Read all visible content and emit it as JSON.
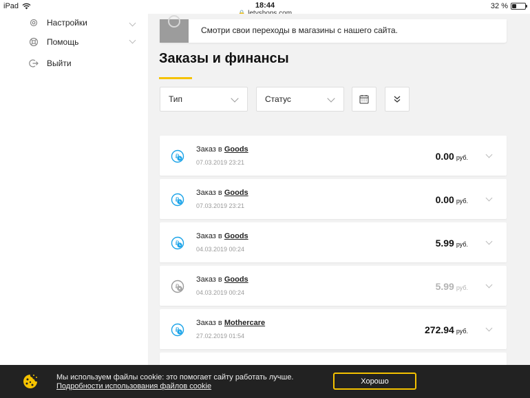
{
  "statusbar": {
    "device": "iPad",
    "time": "18:44",
    "battery": "32 %",
    "battery_level": 0.32
  },
  "browser": {
    "url": "letyshops.com"
  },
  "sidebar": {
    "items": [
      {
        "label": "Настройки",
        "icon": "gear-icon"
      },
      {
        "label": "Помощь",
        "icon": "lifebuoy-icon"
      },
      {
        "label": "Выйти",
        "icon": "logout-icon"
      }
    ]
  },
  "info_card": {
    "text": "Смотри свои переходы в магазины с нашего сайта."
  },
  "section": {
    "title": "Заказы и финансы"
  },
  "filters": {
    "type_label": "Тип",
    "status_label": "Статус"
  },
  "orders": [
    {
      "prefix": "Заказ в",
      "shop": "Goods",
      "date": "07.03.2019 23:21",
      "amount": "0.00",
      "currency": "руб.",
      "status": "pending"
    },
    {
      "prefix": "Заказ в",
      "shop": "Goods",
      "date": "07.03.2019 23:21",
      "amount": "0.00",
      "currency": "руб.",
      "status": "pending"
    },
    {
      "prefix": "Заказ в",
      "shop": "Goods",
      "date": "04.03.2019 00:24",
      "amount": "5.99",
      "currency": "руб.",
      "status": "pending"
    },
    {
      "prefix": "Заказ в",
      "shop": "Goods",
      "date": "04.03.2019 00:24",
      "amount": "5.99",
      "currency": "руб.",
      "status": "cancelled"
    },
    {
      "prefix": "Заказ в",
      "shop": "Mothercare",
      "date": "27.02.2019 01:54",
      "amount": "272.94",
      "currency": "руб.",
      "status": "pending"
    }
  ],
  "cookie": {
    "text": "Мы используем файлы cookie: это помогает сайту работать лучше.",
    "link": "Подробности использования файлов cookie",
    "button": "Хорошо"
  },
  "colors": {
    "accent": "#f5c200",
    "pending_icon": "#1aa3e8",
    "muted_icon": "#9a9a9a",
    "banner_bg": "#222222"
  }
}
